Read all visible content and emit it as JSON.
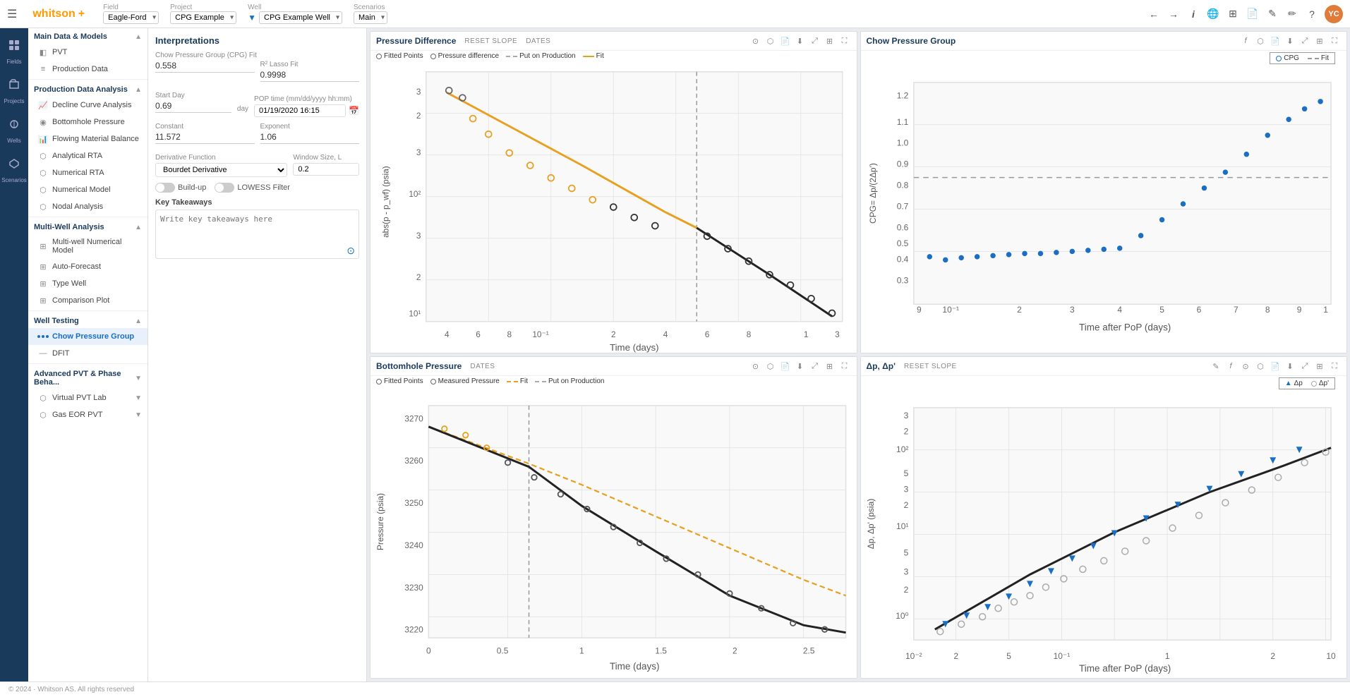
{
  "topbar": {
    "hamburger": "☰",
    "logo": "whitson",
    "logo_plus": "+",
    "field_label": "Field",
    "field_value": "Eagle-Ford",
    "project_label": "Project",
    "project_value": "CPG Example",
    "well_label": "Well",
    "well_value": "CPG Example Well",
    "scenarios_label": "Scenarios",
    "scenarios_value": "Main",
    "nav_back": "←",
    "nav_fwd": "→",
    "info": "i"
  },
  "sidebar_icons": [
    {
      "name": "fields-icon",
      "symbol": "⊞",
      "label": "Fields"
    },
    {
      "name": "projects-icon",
      "symbol": "📁",
      "label": "Projects"
    },
    {
      "name": "wells-icon",
      "symbol": "⬡",
      "label": "Wells"
    },
    {
      "name": "scenarios-icon",
      "symbol": "◈",
      "label": "Scenarios"
    }
  ],
  "sidebar_nav": {
    "main_data_label": "Main Data & Models",
    "pvt_label": "PVT",
    "production_data_label": "Production Data",
    "production_data_analysis_label": "Production Data Analysis",
    "decline_curve_label": "Decline Curve Analysis",
    "bottomhole_pressure_label": "Bottomhole Pressure",
    "flowing_material_balance_label": "Flowing Material Balance",
    "analytical_rta_label": "Analytical RTA",
    "numerical_rta_label": "Numerical RTA",
    "numerical_model_label": "Numerical Model",
    "nodal_analysis_label": "Nodal Analysis",
    "multi_well_label": "Multi-Well Analysis",
    "multi_well_numerical_label": "Multi-well Numerical Model",
    "auto_forecast_label": "Auto-Forecast",
    "type_well_label": "Type Well",
    "comparison_plot_label": "Comparison Plot",
    "well_testing_label": "Well Testing",
    "chow_pressure_label": "Chow Pressure Group",
    "dfit_label": "DFIT",
    "advanced_pvt_label": "Advanced PVT & Phase Beha...",
    "virtual_pvt_label": "Virtual PVT Lab",
    "gas_eor_label": "Gas EOR PVT"
  },
  "interpretations": {
    "title": "Interpretations",
    "cpg_fit_label": "Chow Pressure Group (CPG) Fit",
    "cpg_fit_value": "0.558",
    "r2_label": "R² Lasso Fit",
    "r2_value": "0.9998",
    "start_day_label": "Start Day",
    "start_day_value": "0.69",
    "start_day_unit": "day",
    "pop_time_label": "POP time (mm/dd/yyyy hh:mm)",
    "pop_time_value": "01/19/2020 16:15",
    "constant_label": "Constant",
    "constant_value": "11.572",
    "exponent_label": "Exponent",
    "exponent_value": "1.06",
    "derivative_label": "Derivative Function",
    "derivative_value": "Bourdet Derivative",
    "window_size_label": "Window Size, L",
    "window_size_value": "0.2",
    "build_up_label": "Build-up",
    "lowess_label": "LOWESS Filter",
    "key_takeaways_label": "Key Takeaways",
    "key_takeaways_placeholder": "Write key takeaways here"
  },
  "charts": {
    "pressure_diff": {
      "title": "Pressure Difference",
      "reset_slope": "RESET SLOPE",
      "dates": "DATES",
      "legend": [
        {
          "label": "Fitted Points",
          "type": "circle",
          "color": "#666"
        },
        {
          "label": "Pressure difference",
          "type": "circle",
          "color": "#666"
        },
        {
          "label": "Put on Production",
          "type": "dash",
          "color": "#aaa"
        },
        {
          "label": "Fit",
          "type": "line",
          "color": "#e8a020"
        }
      ],
      "x_label": "Time (days)",
      "y_label": "abs(p - p_wf) (psia)"
    },
    "chow_pressure": {
      "title": "Chow Pressure Group",
      "legend": [
        {
          "label": "CPG",
          "type": "circle",
          "color": "#1a6fc4"
        },
        {
          "label": "Fit",
          "type": "dash",
          "color": "#aaa"
        }
      ],
      "x_label": "Time after PoP (days)",
      "y_label": "CPG= Δp/(2Δp')"
    },
    "bottomhole": {
      "title": "Bottomhole Pressure",
      "dates": "DATES",
      "legend": [
        {
          "label": "Fitted Points",
          "type": "circle",
          "color": "#666"
        },
        {
          "label": "Measured Pressure",
          "type": "circle",
          "color": "#666"
        },
        {
          "label": "Fit",
          "type": "dash",
          "color": "#e8a020"
        },
        {
          "label": "Put on Production",
          "type": "dash",
          "color": "#aaa"
        }
      ],
      "x_label": "Time (days)",
      "y_label": "Pressure (psia)"
    },
    "delta_p": {
      "title": "Δp, Δp'",
      "reset_slope": "RESET SLOPE",
      "legend": [
        {
          "label": "Δp",
          "type": "triangle",
          "color": "#1a6fc4"
        },
        {
          "label": "Δp'",
          "type": "circle",
          "color": "#aaa"
        }
      ],
      "x_label": "Time after PoP (days)",
      "y_label": "Δp, Δp' (psia)"
    }
  },
  "footer": {
    "copyright": "© 2024 · Whitson AS. All rights reserved"
  }
}
